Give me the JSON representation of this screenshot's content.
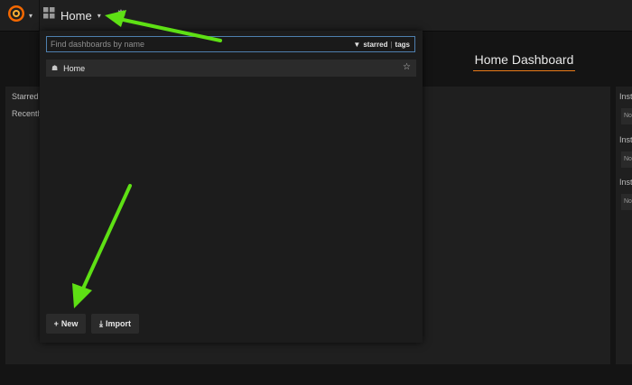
{
  "navbar": {
    "dashboard_title": "Home"
  },
  "page": {
    "title": "Home Dashboard"
  },
  "left_panel": {
    "labels": [
      "Starred",
      "Recently"
    ]
  },
  "right_panel": {
    "labels": [
      "Inst",
      "Inst",
      "Inst"
    ],
    "boxes": [
      "No",
      "No",
      "No"
    ]
  },
  "search": {
    "placeholder": "Find dashboards by name",
    "filter_starred": "starred",
    "filter_separator": "|",
    "filter_tags": "tags"
  },
  "results": [
    {
      "title": "Home"
    }
  ],
  "actions": {
    "new_label": "New",
    "import_label": "Import"
  },
  "colors": {
    "accent": "#eb7b18",
    "annotation_arrow": "#5ee014"
  }
}
